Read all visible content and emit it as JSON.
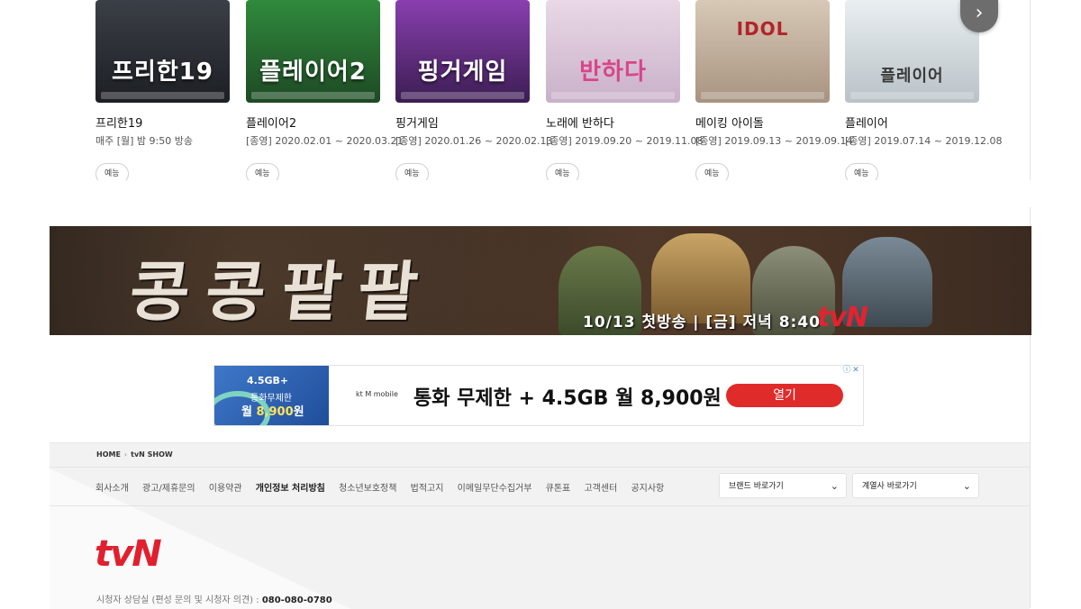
{
  "shows": [
    {
      "title": "프리한19",
      "date": "매주 [월] 밤 9:50 방송",
      "tag": "예능",
      "poster_text": "프리한19",
      "color_top": "#3b3f46",
      "color_bottom": "#1c1f24"
    },
    {
      "title": "플레이어2",
      "date": "[종영] 2020.02.01 ~ 2020.03.21",
      "tag": "예능",
      "poster_text": "플레이어2",
      "color_top": "#2f8a3c",
      "color_bottom": "#1e4a24"
    },
    {
      "title": "핑거게임",
      "date": "[종영] 2020.01.26 ~ 2020.02.13",
      "tag": "예능",
      "poster_text": "핑거게임",
      "color_top": "#8a3fb0",
      "color_bottom": "#3b1d52"
    },
    {
      "title": "노래에 반하다",
      "date": "[종영] 2019.09.20 ~ 2019.11.08",
      "tag": "예능",
      "poster_text": "반하다",
      "color_top": "#e9d8e6",
      "color_bottom": "#c9b1c9"
    },
    {
      "title": "메이킹 아이돌",
      "date": "[종영] 2019.09.13 ~ 2019.09.14",
      "tag": "예능",
      "poster_text": "IDOL",
      "color_top": "#d7c9b6",
      "color_bottom": "#a79380"
    },
    {
      "title": "플레이어",
      "date": "[종영] 2019.07.14 ~ 2019.12.08",
      "tag": "예능",
      "poster_text": "플레이어",
      "color_top": "#e9eef1",
      "color_bottom": "#b9c2c7"
    }
  ],
  "banner": {
    "title": "콩콩팥팥",
    "caption": "10/13 첫방송 | [금] 저녁 8:40",
    "logo": "tvN"
  },
  "ad": {
    "img_line1": "4.5GB+",
    "img_line2": "통화무제한",
    "img_line3_prefix": "월 ",
    "img_line3_price": "8,900",
    "img_line3_suffix": "원",
    "brand": "kt M mobile",
    "headline": "통화 무제한 + 4.5GB 월 8,900원",
    "cta": "열기"
  },
  "footer": {
    "breadcrumb": [
      "HOME",
      "tvN SHOW"
    ],
    "links": [
      "회사소개",
      "광고/제휴문의",
      "이용약관",
      "개인정보 처리방침",
      "청소년보호정책",
      "법적고지",
      "이메일무단수집거부",
      "큐톤표",
      "고객센터",
      "공지사항"
    ],
    "brand_select": "브랜드 바로가기",
    "affiliate_select": "계열사 바로가기",
    "logo": "tvN",
    "contact_label": "시청자 상담실 (편성 문의 및 시청자 의견) : ",
    "contact_phone": "080-080-0780"
  },
  "colors": {
    "brand_red": "#e0202e",
    "ad_cta": "#e02b2b"
  }
}
